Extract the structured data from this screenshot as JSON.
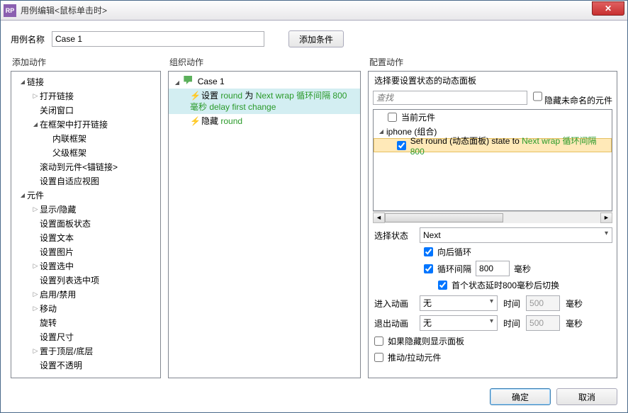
{
  "window_title": "用例编辑<鼠标单击时>",
  "case_name_label": "用例名称",
  "case_name_value": "Case 1",
  "add_condition_btn": "添加条件",
  "columns": {
    "add": "添加动作",
    "org": "组织动作",
    "cfg": "配置动作"
  },
  "add_tree": [
    {
      "lvl": 0,
      "caret": "open",
      "label": "链接"
    },
    {
      "lvl": 1,
      "caret": "closed",
      "label": "打开链接"
    },
    {
      "lvl": 1,
      "caret": "none",
      "label": "关闭窗口"
    },
    {
      "lvl": 1,
      "caret": "open",
      "label": "在框架中打开链接"
    },
    {
      "lvl": 2,
      "caret": "none",
      "label": "内联框架"
    },
    {
      "lvl": 2,
      "caret": "none",
      "label": "父级框架"
    },
    {
      "lvl": 1,
      "caret": "none",
      "label": "滚动到元件<锚链接>"
    },
    {
      "lvl": 1,
      "caret": "none",
      "label": "设置自适应视图"
    },
    {
      "lvl": 0,
      "caret": "open",
      "label": "元件"
    },
    {
      "lvl": 1,
      "caret": "closed",
      "label": "显示/隐藏"
    },
    {
      "lvl": 1,
      "caret": "none",
      "label": "设置面板状态"
    },
    {
      "lvl": 1,
      "caret": "none",
      "label": "设置文本"
    },
    {
      "lvl": 1,
      "caret": "none",
      "label": "设置图片"
    },
    {
      "lvl": 1,
      "caret": "closed",
      "label": "设置选中"
    },
    {
      "lvl": 1,
      "caret": "none",
      "label": "设置列表选中项"
    },
    {
      "lvl": 1,
      "caret": "closed",
      "label": "启用/禁用"
    },
    {
      "lvl": 1,
      "caret": "closed",
      "label": "移动"
    },
    {
      "lvl": 1,
      "caret": "none",
      "label": "旋转"
    },
    {
      "lvl": 1,
      "caret": "none",
      "label": "设置尺寸"
    },
    {
      "lvl": 1,
      "caret": "closed",
      "label": "置于顶层/底层"
    },
    {
      "lvl": 1,
      "caret": "none",
      "label": "设置不透明"
    }
  ],
  "org_case_label": "Case 1",
  "org_actions": [
    {
      "selected": true,
      "pre": "设置 ",
      "g1": "round",
      "mid": " 为 ",
      "g2": "Next wrap 循环间隔 800 毫秒 delay first change"
    },
    {
      "selected": false,
      "pre": "隐藏 ",
      "g1": "round",
      "mid": "",
      "g2": ""
    }
  ],
  "cfg": {
    "select_panel_label": "选择要设置状态的动态面板",
    "search_placeholder": "查找",
    "hide_unnamed_label": "隐藏未命名的元件",
    "current_widget": "当前元件",
    "group_label": "iphone (组合)",
    "item_pre": "Set round (动态面板) state to ",
    "item_green": "Next wrap 循环间隔 800",
    "select_state_label": "选择状态",
    "select_state_value": "Next",
    "wrap_label": "向后循环",
    "loop_interval_label": "循环间隔",
    "loop_interval_value": "800",
    "loop_unit": "毫秒",
    "delay_first_label": "首个状态延时800毫秒后切换",
    "anim_in_label": "进入动画",
    "anim_out_label": "退出动画",
    "anim_none": "无",
    "time_label": "时间",
    "time_value": "500",
    "time_unit": "毫秒",
    "show_if_hidden": "如果隐藏则显示面板",
    "push_pull": "推动/拉动元件"
  },
  "ok_btn": "确定",
  "cancel_btn": "取消"
}
